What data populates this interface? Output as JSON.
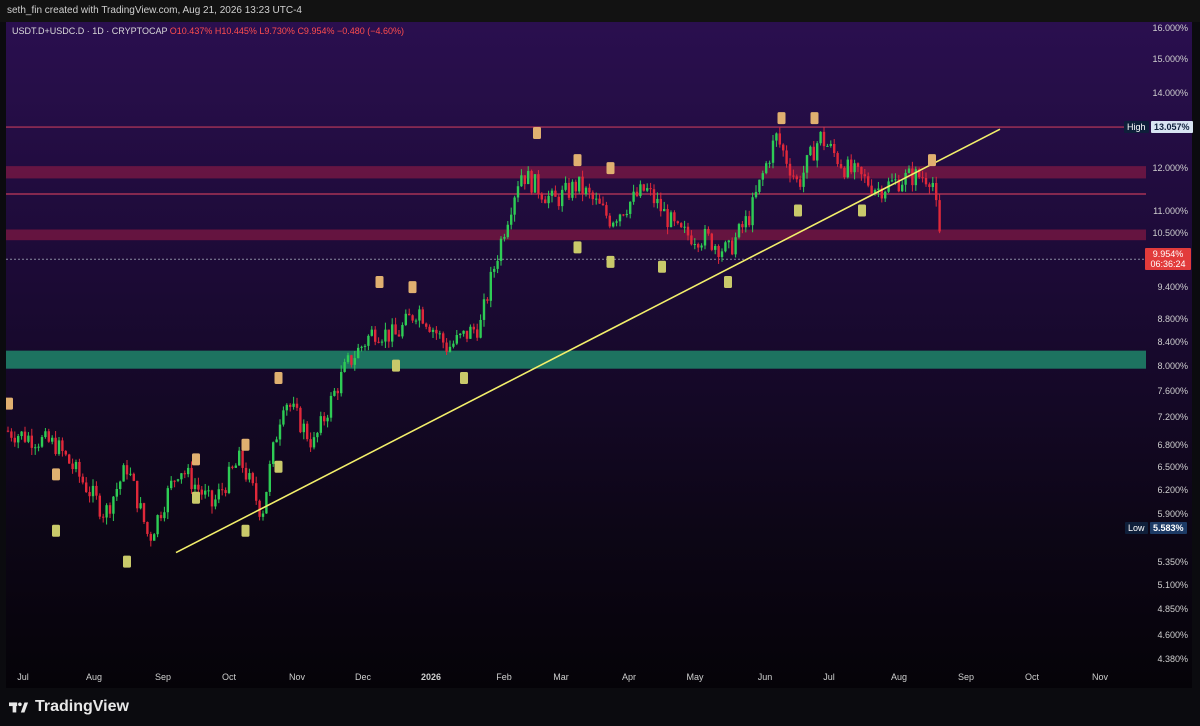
{
  "header": {
    "text": "seth_fin created with TradingView.com, Aug 21, 2026 13:23 UTC-4"
  },
  "symbol": {
    "label": "USDT.D+USDC.D · 1D · CRYPTOCAP",
    "o": "O10.437%",
    "h": "H10.445%",
    "l": "L9.730%",
    "c": "C9.954%",
    "chg": "−0.480 (−4.60%)"
  },
  "y_axis": {
    "ticks": [
      "16.000%",
      "15.000%",
      "14.000%",
      "12.000%",
      "11.000%",
      "10.500%",
      "9.400%",
      "8.800%",
      "8.400%",
      "8.000%",
      "7.600%",
      "7.200%",
      "6.800%",
      "6.500%",
      "6.200%",
      "5.900%",
      "5.350%",
      "5.100%",
      "4.850%",
      "4.600%",
      "4.380%"
    ],
    "high_label": "High",
    "high_value": "13.057%",
    "low_label": "Low",
    "low_value": "5.583%",
    "price_value": "9.954%",
    "countdown": "06:36:24"
  },
  "x_axis": {
    "ticks": [
      "Jul",
      "Aug",
      "Sep",
      "Oct",
      "Nov",
      "Dec",
      "2026",
      "Feb",
      "Mar",
      "Apr",
      "May",
      "Jun",
      "Jul",
      "Aug",
      "Sep",
      "Oct",
      "Nov"
    ]
  },
  "footer": {
    "brand": "TradingView"
  },
  "colors": {
    "up": "#2ecc55",
    "down": "#e0283a",
    "trendline": "#f3ef6b",
    "resistance_zone": "#a01e46",
    "support_zone": "#1f8f6e",
    "pivot_high": "#e0b070",
    "pivot_low": "#c9c96a"
  },
  "chart_data": {
    "type": "candlestick",
    "scale": "log",
    "ylim": [
      4.3,
      16.2
    ],
    "series_close_waypoints": [
      {
        "x": "Jun 2025",
        "y": 7.0
      },
      {
        "x": "Jul 2025",
        "y": 6.8
      },
      {
        "x": "Aug 2025",
        "y": 5.9
      },
      {
        "x": "Aug 2025",
        "y": 6.5
      },
      {
        "x": "Aug 2025",
        "y": 5.6
      },
      {
        "x": "Sep 2025",
        "y": 6.5
      },
      {
        "x": "Sep 2025",
        "y": 6.0
      },
      {
        "x": "Oct 2025",
        "y": 6.6
      },
      {
        "x": "Oct 2025",
        "y": 5.9
      },
      {
        "x": "Oct 2025",
        "y": 7.5
      },
      {
        "x": "Nov 2025",
        "y": 6.8
      },
      {
        "x": "Nov 2025",
        "y": 8.0
      },
      {
        "x": "Dec 2025",
        "y": 8.6
      },
      {
        "x": "Dec 2025",
        "y": 8.5
      },
      {
        "x": "Dec 2025",
        "y": 9.0
      },
      {
        "x": "Jan 2026",
        "y": 8.3
      },
      {
        "x": "Jan 2026",
        "y": 8.7
      },
      {
        "x": "Feb 2026",
        "y": 11.9
      },
      {
        "x": "Feb 2026",
        "y": 11.2
      },
      {
        "x": "Mar 2026",
        "y": 11.6
      },
      {
        "x": "Mar 2026",
        "y": 10.8
      },
      {
        "x": "Apr 2026",
        "y": 11.5
      },
      {
        "x": "Apr 2026",
        "y": 10.5
      },
      {
        "x": "May 2026",
        "y": 10.4
      },
      {
        "x": "May 2026",
        "y": 10.1
      },
      {
        "x": "May 2026",
        "y": 10.9
      },
      {
        "x": "Jun 2026",
        "y": 12.8
      },
      {
        "x": "Jun 2026",
        "y": 11.6
      },
      {
        "x": "Jun 2026",
        "y": 12.8
      },
      {
        "x": "Jul 2026",
        "y": 12.0
      },
      {
        "x": "Jul 2026",
        "y": 11.5
      },
      {
        "x": "Aug 2026",
        "y": 11.8
      },
      {
        "x": "Aug 2026",
        "y": 11.8
      },
      {
        "x": "Aug 2026",
        "y": 9.95
      }
    ],
    "levels": {
      "high_line": 13.057,
      "resistance_zone": [
        11.75,
        12.05
      ],
      "resistance_line": 11.38,
      "resistance_zone_2": [
        10.35,
        10.58
      ],
      "current_price_line": 9.954,
      "support_zone": [
        7.95,
        8.25
      ]
    },
    "trendline": [
      {
        "x": "Sep 2025",
        "y": 5.45
      },
      {
        "x": "Sep 2026",
        "y": 13.0
      }
    ],
    "pivot_highs": [
      {
        "x": "Jun 2025",
        "y": 7.4
      },
      {
        "x": "Jul 2025",
        "y": 6.4
      },
      {
        "x": "Sep 2025",
        "y": 6.6
      },
      {
        "x": "Oct 2025",
        "y": 6.8
      },
      {
        "x": "Oct 2025",
        "y": 7.8
      },
      {
        "x": "Dec 2025",
        "y": 9.5
      },
      {
        "x": "Dec 2025",
        "y": 9.4
      },
      {
        "x": "Feb 2026",
        "y": 12.9
      },
      {
        "x": "Mar 2026",
        "y": 12.2
      },
      {
        "x": "Mar 2026",
        "y": 12.0
      },
      {
        "x": "Jun 2026",
        "y": 13.3
      },
      {
        "x": "Jun 2026",
        "y": 13.3
      },
      {
        "x": "Aug 2026",
        "y": 12.2
      }
    ],
    "pivot_lows": [
      {
        "x": "Jul 2025",
        "y": 5.7
      },
      {
        "x": "Aug 2025",
        "y": 5.35
      },
      {
        "x": "Sep 2025",
        "y": 6.1
      },
      {
        "x": "Oct 2025",
        "y": 5.7
      },
      {
        "x": "Oct 2025",
        "y": 6.5
      },
      {
        "x": "Dec 2025",
        "y": 8.0
      },
      {
        "x": "Jan 2026",
        "y": 7.8
      },
      {
        "x": "Mar 2026",
        "y": 10.2
      },
      {
        "x": "Mar 2026",
        "y": 9.9
      },
      {
        "x": "Apr 2026",
        "y": 9.8
      },
      {
        "x": "May 2026",
        "y": 9.5
      },
      {
        "x": "Jun 2026",
        "y": 11.0
      },
      {
        "x": "Jul 2026",
        "y": 11.0
      }
    ]
  }
}
